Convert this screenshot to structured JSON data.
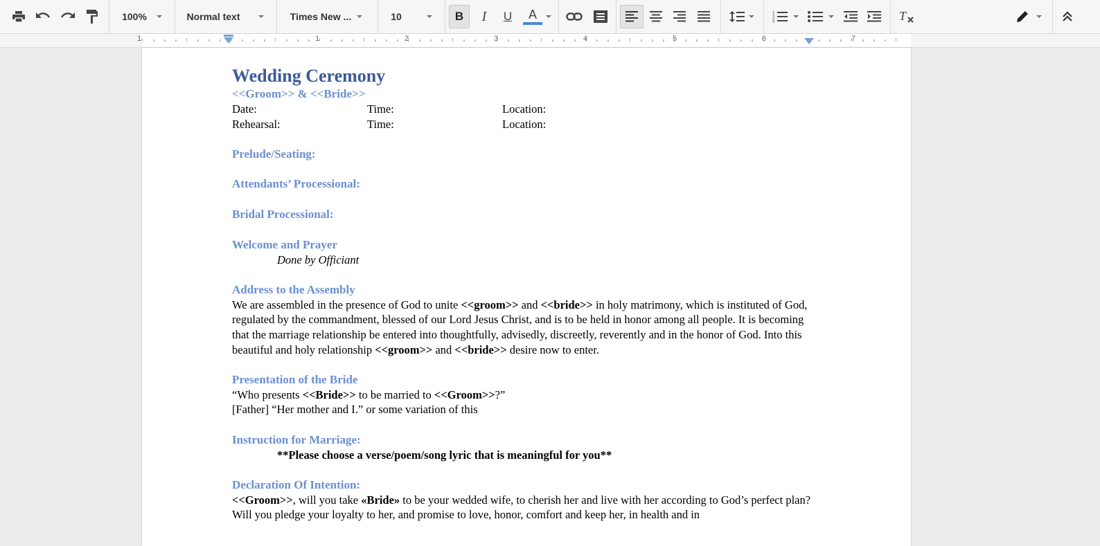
{
  "toolbar": {
    "zoom": "100%",
    "style": "Normal text",
    "font": "Times New ...",
    "font_size": "10",
    "bold_label": "B",
    "italic_label": "I",
    "underline_label": "U",
    "text_color_label": "A",
    "accent_color": "#4a86d9"
  },
  "ruler": {
    "numbers": [
      "1",
      "1",
      "2",
      "3",
      "4",
      "5",
      "6",
      "7"
    ]
  },
  "doc": {
    "title": "Wedding Ceremony",
    "subtitle": "<<Groom>> & <<Bride>>",
    "info_rows": [
      [
        "Date:",
        "Time:",
        "Location:"
      ],
      [
        "Rehearsal:",
        "Time:",
        "Location:"
      ]
    ],
    "prelude": "Prelude/Seating:",
    "attendants": "Attendants’ Processional:",
    "bridal": "Bridal Processional:",
    "welcome": "Welcome and Prayer",
    "welcome_note": "Done by Officiant",
    "address": "Address to the Assembly",
    "address_p": [
      "We are assembled in the presence of God to unite ",
      "<<groom>>",
      " and ",
      "<<bride>>",
      " in holy matrimony, which is instituted of God, regulated by the commandment, blessed of our Lord Jesus Christ, and is to be held in honor among all people.  It is becoming that the marriage relationship be entered into thoughtfully, advisedly, discreetly, reverently and in the honor of God.  Into this beautiful and holy relationship ",
      "<<groom>>",
      " and ",
      "<<bride>>",
      " desire now to enter."
    ],
    "presentation": "Presentation of the Bride",
    "pres_line1": [
      "“Who presents ",
      "<<Bride>>",
      " to be married to ",
      "<<Groom>>",
      "?”"
    ],
    "pres_line2": "[Father] “Her mother and I.” or some variation of this",
    "instruction": "Instruction for Marriage:",
    "instruction_note": "**Please choose a verse/poem/song lyric that is meaningful for you**",
    "declaration": "Declaration Of Intention:",
    "decl_p": [
      "<<Groom>>",
      ", will you take ",
      "«Bride»",
      " to be your wedded wife, to cherish her and live with her according to God’s perfect plan?  Will you pledge your loyalty to her, and promise to love, honor, comfort and keep her, in health and in"
    ]
  }
}
